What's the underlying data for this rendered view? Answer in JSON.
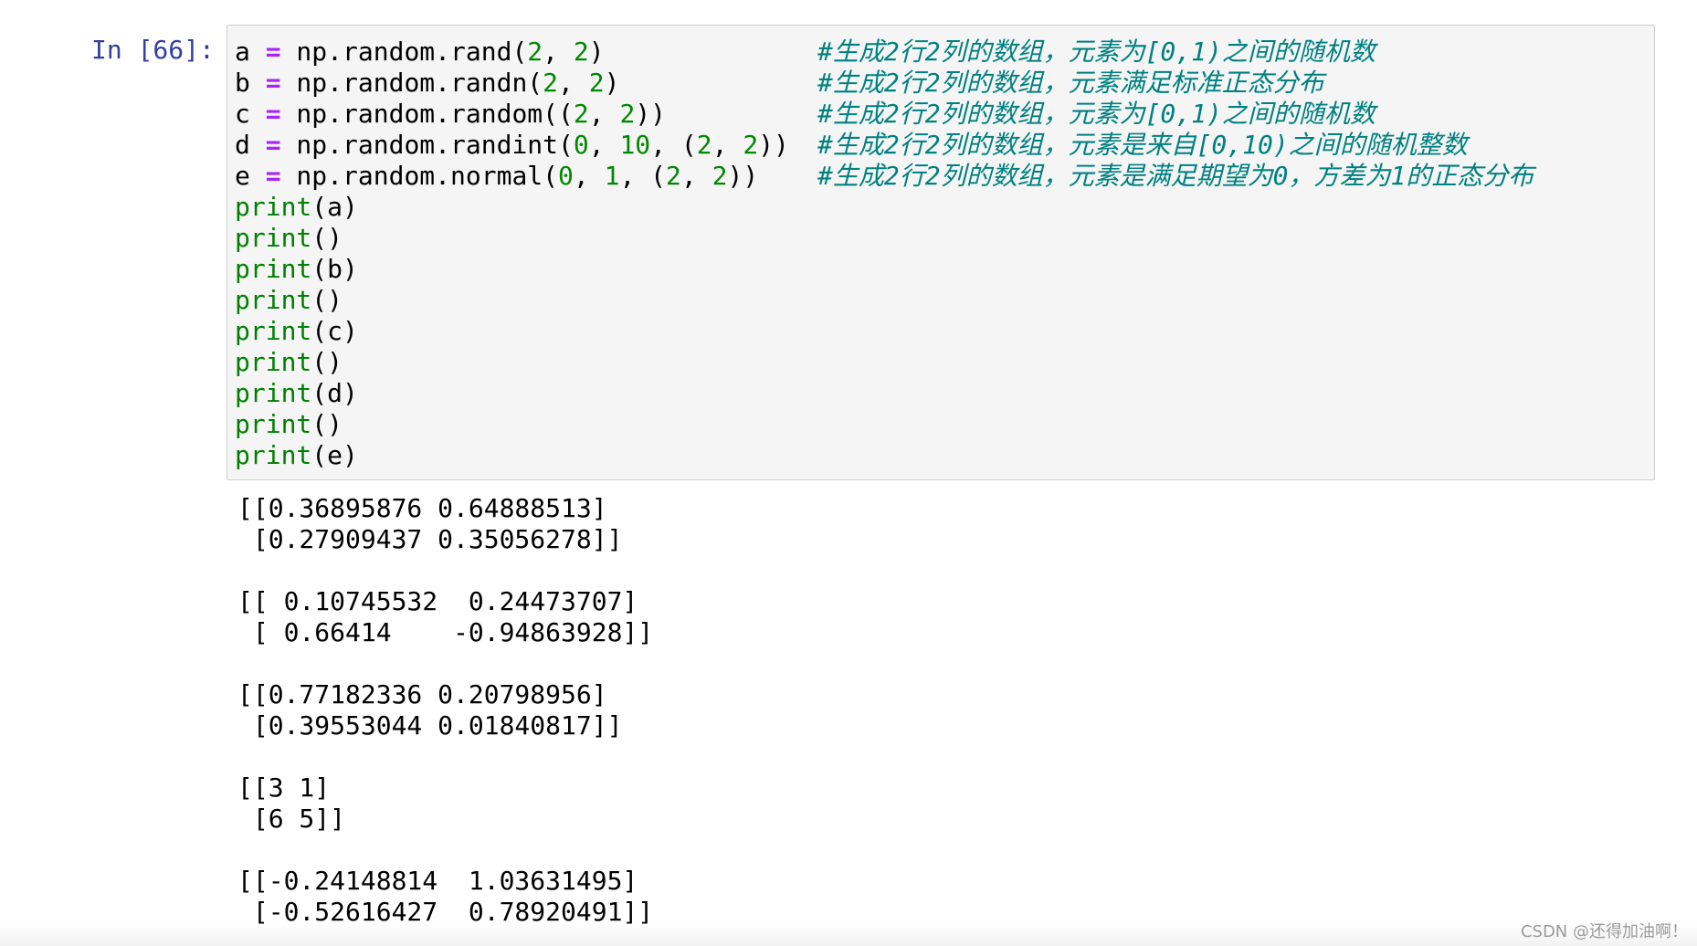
{
  "cell": {
    "prompt": "In [66]:",
    "code_lines": [
      {
        "tokens": [
          {
            "t": "a ",
            "k": "name"
          },
          {
            "t": "=",
            "k": "op"
          },
          {
            "t": " np.random.rand(",
            "k": "name"
          },
          {
            "t": "2",
            "k": "num"
          },
          {
            "t": ", ",
            "k": "name"
          },
          {
            "t": "2",
            "k": "num"
          },
          {
            "t": ")",
            "k": "name"
          }
        ],
        "comment": "#生成2行2列的数组，元素为[0,1)之间的随机数"
      },
      {
        "tokens": [
          {
            "t": "b ",
            "k": "name"
          },
          {
            "t": "=",
            "k": "op"
          },
          {
            "t": " np.random.randn(",
            "k": "name"
          },
          {
            "t": "2",
            "k": "num"
          },
          {
            "t": ", ",
            "k": "name"
          },
          {
            "t": "2",
            "k": "num"
          },
          {
            "t": ")",
            "k": "name"
          }
        ],
        "comment": "#生成2行2列的数组，元素满足标准正态分布"
      },
      {
        "tokens": [
          {
            "t": "c ",
            "k": "name"
          },
          {
            "t": "=",
            "k": "op"
          },
          {
            "t": " np.random.random((",
            "k": "name"
          },
          {
            "t": "2",
            "k": "num"
          },
          {
            "t": ", ",
            "k": "name"
          },
          {
            "t": "2",
            "k": "num"
          },
          {
            "t": "))",
            "k": "name"
          }
        ],
        "comment": "#生成2行2列的数组，元素为[0,1)之间的随机数"
      },
      {
        "tokens": [
          {
            "t": "d ",
            "k": "name"
          },
          {
            "t": "=",
            "k": "op"
          },
          {
            "t": " np.random.randint(",
            "k": "name"
          },
          {
            "t": "0",
            "k": "num"
          },
          {
            "t": ", ",
            "k": "name"
          },
          {
            "t": "10",
            "k": "num"
          },
          {
            "t": ", (",
            "k": "name"
          },
          {
            "t": "2",
            "k": "num"
          },
          {
            "t": ", ",
            "k": "name"
          },
          {
            "t": "2",
            "k": "num"
          },
          {
            "t": "))",
            "k": "name"
          }
        ],
        "comment": "#生成2行2列的数组，元素是来自[0,10)之间的随机整数"
      },
      {
        "tokens": [
          {
            "t": "e ",
            "k": "name"
          },
          {
            "t": "=",
            "k": "op"
          },
          {
            "t": " np.random.normal(",
            "k": "name"
          },
          {
            "t": "0",
            "k": "num"
          },
          {
            "t": ", ",
            "k": "name"
          },
          {
            "t": "1",
            "k": "num"
          },
          {
            "t": ", (",
            "k": "name"
          },
          {
            "t": "2",
            "k": "num"
          },
          {
            "t": ", ",
            "k": "name"
          },
          {
            "t": "2",
            "k": "num"
          },
          {
            "t": "))",
            "k": "name"
          }
        ],
        "comment": "#生成2行2列的数组，元素是满足期望为0，方差为1的正态分布"
      },
      {
        "tokens": [
          {
            "t": "print",
            "k": "builtin"
          },
          {
            "t": "(a)",
            "k": "name"
          }
        ],
        "comment": ""
      },
      {
        "tokens": [
          {
            "t": "print",
            "k": "builtin"
          },
          {
            "t": "()",
            "k": "name"
          }
        ],
        "comment": ""
      },
      {
        "tokens": [
          {
            "t": "print",
            "k": "builtin"
          },
          {
            "t": "(b)",
            "k": "name"
          }
        ],
        "comment": ""
      },
      {
        "tokens": [
          {
            "t": "print",
            "k": "builtin"
          },
          {
            "t": "()",
            "k": "name"
          }
        ],
        "comment": ""
      },
      {
        "tokens": [
          {
            "t": "print",
            "k": "builtin"
          },
          {
            "t": "(c)",
            "k": "name"
          }
        ],
        "comment": ""
      },
      {
        "tokens": [
          {
            "t": "print",
            "k": "builtin"
          },
          {
            "t": "()",
            "k": "name"
          }
        ],
        "comment": ""
      },
      {
        "tokens": [
          {
            "t": "print",
            "k": "builtin"
          },
          {
            "t": "(d)",
            "k": "name"
          }
        ],
        "comment": ""
      },
      {
        "tokens": [
          {
            "t": "print",
            "k": "builtin"
          },
          {
            "t": "()",
            "k": "name"
          }
        ],
        "comment": ""
      },
      {
        "tokens": [
          {
            "t": "print",
            "k": "builtin"
          },
          {
            "t": "(e)",
            "k": "name"
          }
        ],
        "comment": ""
      }
    ],
    "output_lines": [
      "[[0.36895876 0.64888513]",
      " [0.27909437 0.35056278]]",
      "",
      "[[ 0.10745532  0.24473707]",
      " [ 0.66414    -0.94863928]]",
      "",
      "[[0.77182336 0.20798956]",
      " [0.39553044 0.01840817]]",
      "",
      "[[3 1]",
      " [6 5]]",
      "",
      "[[-0.24148814  1.03631495]",
      " [-0.52616427  0.78920491]]"
    ]
  },
  "watermark": "CSDN @还得加油啊！",
  "colors": {
    "prompt": "#303F9F",
    "operator": "#AA22FF",
    "number": "#008800",
    "builtin": "#008000",
    "comment": "#008080",
    "input_background": "#f5f5f5",
    "input_border": "#cfcfcf"
  }
}
